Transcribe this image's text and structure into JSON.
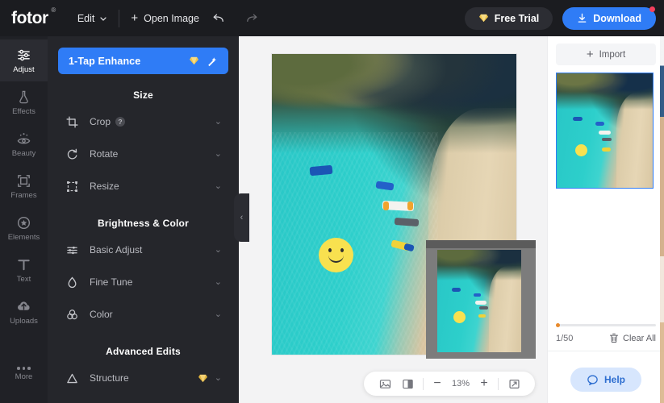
{
  "header": {
    "logo": "fotor",
    "logo_mark": "®",
    "edit_label": "Edit",
    "open_image_label": "Open Image",
    "undo_icon": "undo-arrow-icon",
    "redo_icon": "redo-arrow-icon",
    "free_trial_label": "Free Trial",
    "download_label": "Download",
    "accent_blue": "#2f7cf6",
    "badge_color": "#f5405e"
  },
  "sidebar": {
    "items": [
      {
        "label": "Adjust",
        "icon": "sliders-icon",
        "active": true
      },
      {
        "label": "Effects",
        "icon": "flask-icon",
        "active": false
      },
      {
        "label": "Beauty",
        "icon": "eye-icon",
        "active": false
      },
      {
        "label": "Frames",
        "icon": "frame-icon",
        "active": false
      },
      {
        "label": "Elements",
        "icon": "star-badge-icon",
        "active": false
      },
      {
        "label": "Text",
        "icon": "text-t-icon",
        "active": false
      },
      {
        "label": "Uploads",
        "icon": "upload-cloud-icon",
        "active": false
      }
    ],
    "more_label": "More",
    "more_icon": "dots-icon"
  },
  "panel": {
    "enhance_label": "1-Tap Enhance",
    "enhance_badge_icon": "gem-icon",
    "enhance_wand_icon": "magic-wand-icon",
    "sections": [
      {
        "title": "Size",
        "rows": [
          {
            "label": "Crop",
            "icon": "crop-icon",
            "help": "?",
            "premium": false
          },
          {
            "label": "Rotate",
            "icon": "rotate-icon",
            "help": "",
            "premium": false
          },
          {
            "label": "Resize",
            "icon": "resize-icon",
            "help": "",
            "premium": false
          }
        ]
      },
      {
        "title": "Brightness & Color",
        "rows": [
          {
            "label": "Basic Adjust",
            "icon": "sliders-icon",
            "help": "",
            "premium": false
          },
          {
            "label": "Fine Tune",
            "icon": "droplet-icon",
            "help": "",
            "premium": false
          },
          {
            "label": "Color",
            "icon": "color-rings-icon",
            "help": "",
            "premium": false
          }
        ]
      },
      {
        "title": "Advanced Edits",
        "rows": [
          {
            "label": "Structure",
            "icon": "triangle-icon",
            "help": "",
            "premium": true
          }
        ]
      }
    ],
    "collapse_icon": "chevron-left-icon",
    "expand_icon": "chevron-down-icon"
  },
  "canvas": {
    "image_alt": "aerial-beach-photo",
    "sticker": "yellow-smiley-sticker",
    "navigator_alt": "navigator-preview-thumbnail",
    "expand_right_icon": "chevron-right-icon"
  },
  "bottom_toolbar": {
    "image_icon": "image-icon",
    "compare_icon": "before-after-compare-icon",
    "zoom_out": "−",
    "zoom_value": "13%",
    "zoom_in": "+",
    "fit_icon": "fit-screen-icon"
  },
  "right_panel": {
    "import_label": "Import",
    "import_icon": "plus-icon",
    "count_label": "1/50",
    "clear_all_label": "Clear All",
    "trash_icon": "trash-icon",
    "help_label": "Help",
    "help_icon": "chat-bubble-icon",
    "thumb_alt": "uploaded-image-thumbnail",
    "selected_border": "#2f7cf6"
  }
}
